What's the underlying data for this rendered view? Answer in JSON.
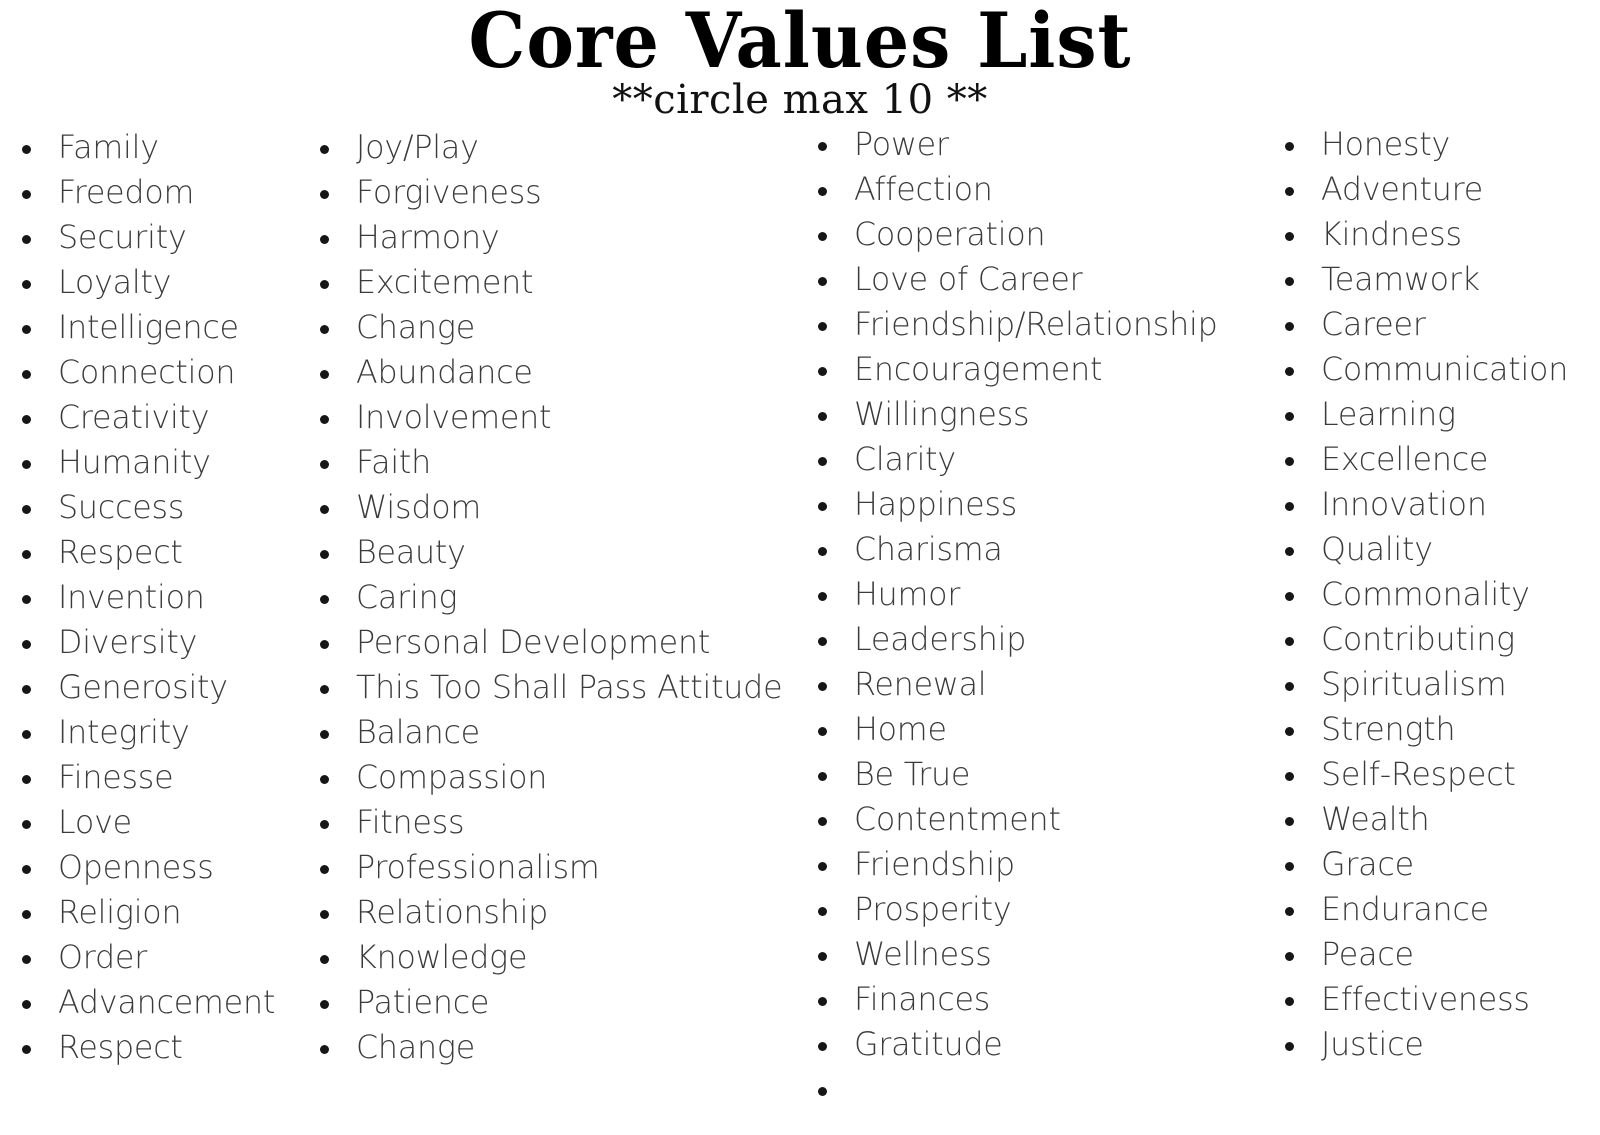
{
  "header": {
    "title": "Core Values List",
    "subtitle": "**circle max 10 **"
  },
  "theme": {
    "background": "#ffffff",
    "title_color": "#000000",
    "subtitle_color": "#111111",
    "item_color": "#3b3b3b",
    "bullet_color": "#161616"
  },
  "columns": [
    {
      "id": "column-1",
      "items": [
        "Family",
        "Freedom",
        "Security",
        "Loyalty",
        "Intelligence",
        "Connection",
        "Creativity",
        "Humanity",
        "Success",
        "Respect",
        "Invention",
        "Diversity",
        "Generosity",
        "Integrity",
        "Finesse",
        "Love",
        "Openness",
        "Religion",
        "Order",
        "Advancement",
        "Respect"
      ]
    },
    {
      "id": "column-2",
      "items": [
        "Joy/Play",
        "Forgiveness",
        "Harmony",
        "Excitement",
        "Change",
        "Abundance",
        "Involvement",
        "Faith",
        "Wisdom",
        "Beauty",
        "Caring",
        "Personal Development",
        "This Too Shall Pass Attitude",
        "Balance",
        "Compassion",
        "Fitness",
        "Professionalism",
        "Relationship",
        "Knowledge",
        "Patience",
        "Change"
      ]
    },
    {
      "id": "column-3",
      "items": [
        "Power",
        "Affection",
        "Cooperation",
        "Love of Career",
        "Friendship/Relationship",
        "Encouragement",
        "Willingness",
        "Clarity",
        "Happiness",
        "Charisma",
        "Humor",
        "Leadership",
        "Renewal",
        "Home",
        "Be True",
        "Contentment",
        "Friendship",
        "Prosperity",
        "Wellness",
        "Finances",
        "Gratitude",
        ""
      ]
    },
    {
      "id": "column-4",
      "items": [
        "Honesty",
        "Adventure",
        "Kindness",
        "Teamwork",
        "Career",
        "Communication",
        "Learning",
        "Excellence",
        "Innovation",
        "Quality",
        "Commonality",
        "Contributing",
        "Spiritualism",
        "Strength",
        "Self-Respect",
        "Wealth",
        "Grace",
        "Endurance",
        "Peace",
        "Effectiveness",
        "Justice"
      ]
    }
  ]
}
